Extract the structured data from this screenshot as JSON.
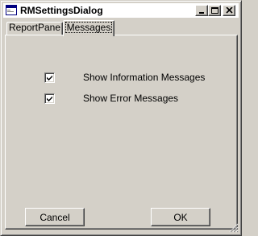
{
  "window": {
    "title": "RMSettingsDialog",
    "icon": "window-app-icon",
    "controls": [
      "minimize-icon",
      "maximize-icon",
      "close-icon"
    ]
  },
  "tabs": [
    {
      "label": "ReportPane",
      "selected": false
    },
    {
      "label": "Messages",
      "selected": true
    }
  ],
  "messages": {
    "show_information": {
      "label": "Show Information Messages",
      "checked": true
    },
    "show_error": {
      "label": "Show Error Messages",
      "checked": true
    }
  },
  "buttons": {
    "cancel": "Cancel",
    "ok": "OK"
  },
  "colors": {
    "face": "#d4d0c8",
    "highlight": "#ffffff",
    "shadow": "#808080",
    "dark_shadow": "#404040"
  }
}
